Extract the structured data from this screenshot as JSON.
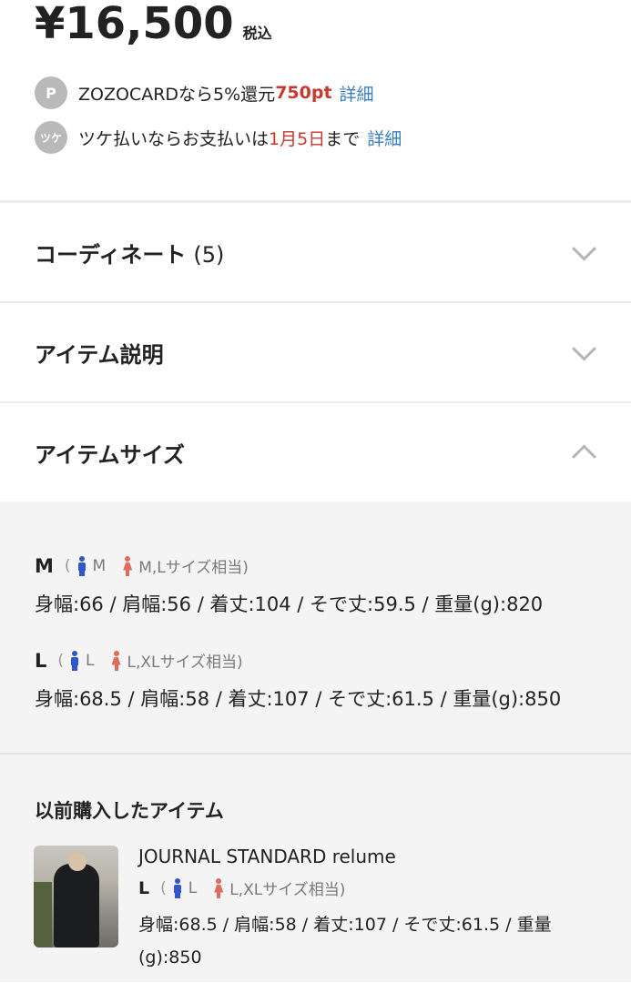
{
  "price": {
    "amount": "¥16,500",
    "tax_label": "税込"
  },
  "benefits": [
    {
      "icon_text": "P",
      "text_before": "ZOZOCARDなら5%還元 ",
      "highlight": "750pt",
      "text_after": "",
      "link": "詳細"
    },
    {
      "icon_text": "ツケ",
      "text_before": "ツケ払いならお支払いは",
      "highlight": "1月5日",
      "text_after": "まで",
      "link": "詳細"
    }
  ],
  "sections": [
    {
      "title": "コーディネート",
      "count": "(5)",
      "state": "collapsed"
    },
    {
      "title": "アイテム説明",
      "count": "",
      "state": "collapsed"
    },
    {
      "title": "アイテムサイズ",
      "count": "",
      "state": "expanded"
    }
  ],
  "sizes": [
    {
      "label": "M",
      "paren_open": "(",
      "male": "M",
      "female": "M,Lサイズ相当)",
      "measurements": "身幅:66 / 肩幅:56 / 着丈:104 / そで丈:59.5 / 重量(g):820"
    },
    {
      "label": "L",
      "paren_open": "(",
      "male": "L",
      "female": "L,XLサイズ相当)",
      "measurements": "身幅:68.5 / 肩幅:58 / 着丈:107 / そで丈:61.5 / 重量(g):850"
    }
  ],
  "previous_purchase": {
    "title": "以前購入したアイテム",
    "brand": "JOURNAL STANDARD relume",
    "size_label": "L",
    "paren_open": "(",
    "male": "L",
    "female": "L,XLサイズ相当)",
    "measurements": "身幅:68.5 / 肩幅:58 / 着丈:107 / そで丈:61.5 / 重量(g):850"
  },
  "colors": {
    "accent_red": "#c7392c",
    "link_blue": "#3b7dbf",
    "male_icon": "#2f57c9",
    "female_icon": "#e16a5e"
  },
  "icons": {
    "collapsed": "chevron-down-icon",
    "expanded": "chevron-up-icon"
  }
}
